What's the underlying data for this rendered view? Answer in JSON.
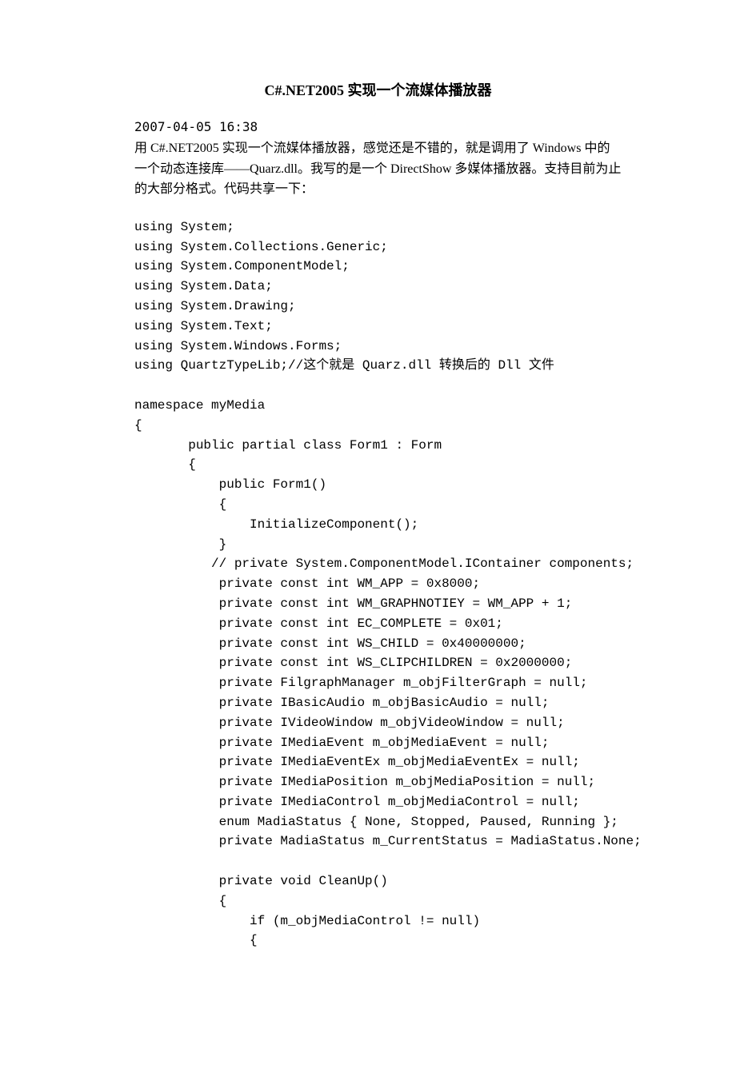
{
  "title": "C#.NET2005 实现一个流媒体播放器",
  "date": "2007-04-05 16:38",
  "intro": "用 C#.NET2005 实现一个流媒体播放器，感觉还是不错的，就是调用了 Windows 中的一个动态连接库——Quarz.dll。我写的是一个 DirectShow 多媒体播放器。支持目前为止的大部分格式。代码共享一下：",
  "code": "using System;\nusing System.Collections.Generic;\nusing System.ComponentModel;\nusing System.Data;\nusing System.Drawing;\nusing System.Text;\nusing System.Windows.Forms;\nusing QuartzTypeLib;//这个就是 Quarz.dll 转换后的 Dll 文件\n\nnamespace myMedia\n{\n       public partial class Form1 : Form\n       {\n           public Form1()\n           {\n               InitializeComponent();\n           }\n          // private System.ComponentModel.IContainer components;\n           private const int WM_APP = 0x8000;\n           private const int WM_GRAPHNOTIEY = WM_APP + 1;\n           private const int EC_COMPLETE = 0x01;\n           private const int WS_CHILD = 0x40000000;\n           private const int WS_CLIPCHILDREN = 0x2000000;\n           private FilgraphManager m_objFilterGraph = null;\n           private IBasicAudio m_objBasicAudio = null;\n           private IVideoWindow m_objVideoWindow = null;\n           private IMediaEvent m_objMediaEvent = null;\n           private IMediaEventEx m_objMediaEventEx = null;\n           private IMediaPosition m_objMediaPosition = null;\n           private IMediaControl m_objMediaControl = null;\n           enum MadiaStatus { None, Stopped, Paused, Running };\n           private MadiaStatus m_CurrentStatus = MadiaStatus.None;\n\n           private void CleanUp()\n           {\n               if (m_objMediaControl != null)\n               {"
}
